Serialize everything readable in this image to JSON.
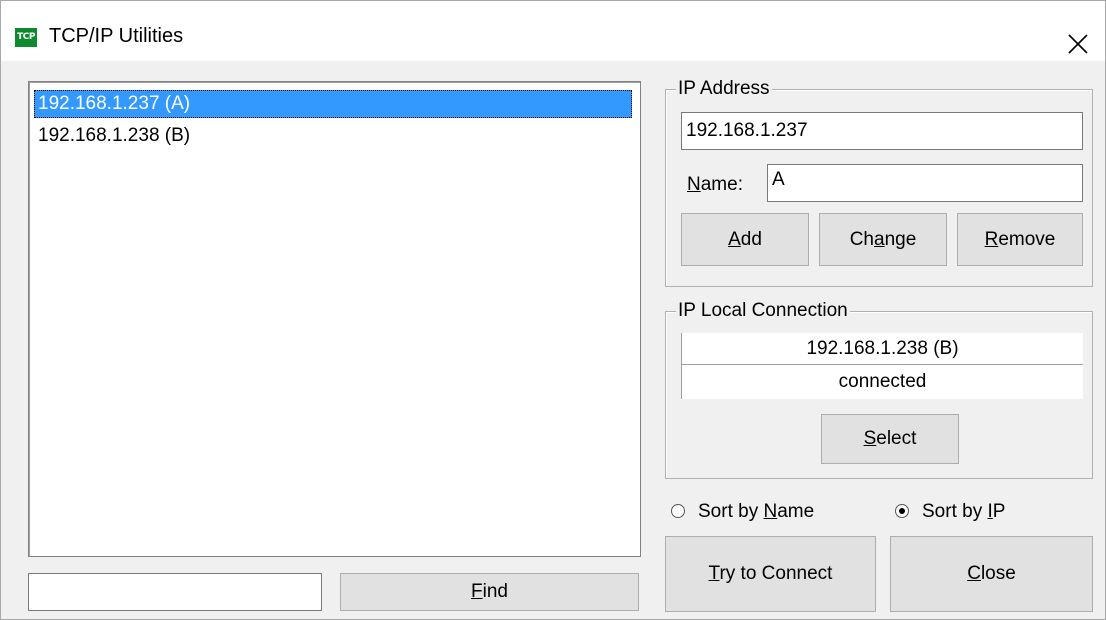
{
  "window": {
    "title": "TCP/IP Utilities",
    "app_icon_text": "TCP",
    "close_glyph": "close-icon"
  },
  "host_list": {
    "items": [
      {
        "label": "192.168.1.237 (A)",
        "selected": true
      },
      {
        "label": "192.168.1.238 (B)",
        "selected": false
      }
    ]
  },
  "find": {
    "input_value": "",
    "button_label": "Find",
    "mnemonic": "F"
  },
  "ip_address_group": {
    "legend": "IP Address",
    "ip_value": "192.168.1.237",
    "name_label": "Name:",
    "name_value": "A",
    "buttons": {
      "add": "Add",
      "change": "Change",
      "remove": "Remove"
    }
  },
  "local_connection_group": {
    "legend": "IP Local Connection",
    "host": "192.168.1.238 (B)",
    "status": "connected",
    "select_label": "Select"
  },
  "sort": {
    "by_name_label": "Sort by Name",
    "by_ip_label": "Sort by IP",
    "selected": "ip"
  },
  "actions": {
    "connect_label": "Try to Connect",
    "close_label": "Close"
  },
  "colors": {
    "selection": "#3399ff",
    "icon_bg": "#0d8a2e",
    "button_face": "#e1e1e1"
  }
}
